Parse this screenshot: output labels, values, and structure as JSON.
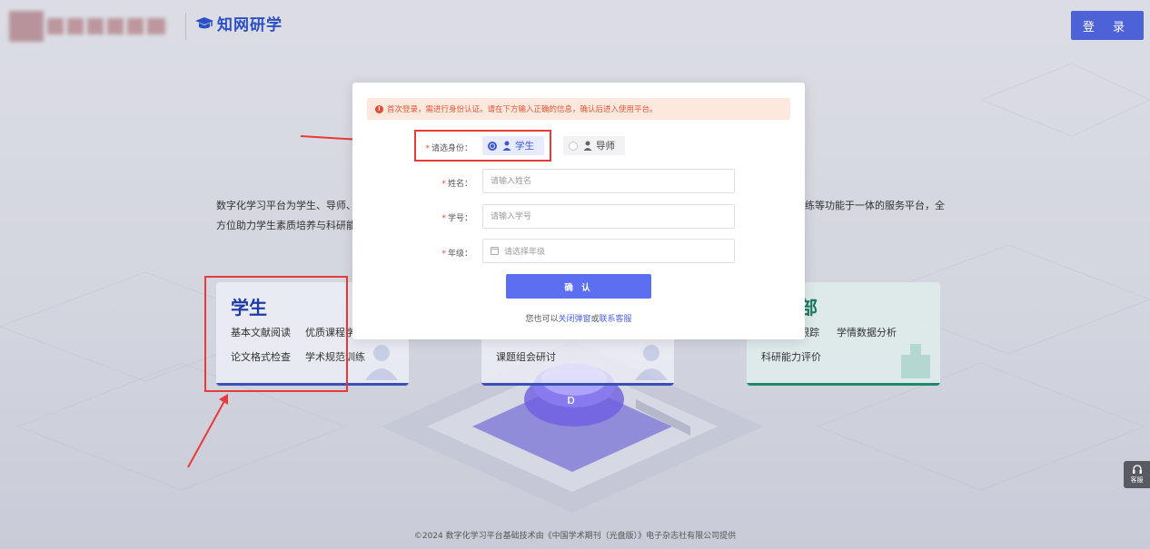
{
  "header": {
    "brand_logo_text": "知网研学",
    "login_label": "登 录"
  },
  "intro": {
    "left_text": "数字化学习平台为学生、导师、方位助力学生素质培养与科研能",
    "right_text": "练等功能于一体的服务平台，全"
  },
  "cards": {
    "student": {
      "title": "学生",
      "features": [
        "基本文献阅读",
        "优质课程学",
        "论文格式检查",
        "学术规范训练"
      ]
    },
    "mentor": {
      "features": [
        "课题组会研讨"
      ]
    },
    "dept": {
      "title": "部",
      "features": [
        "跟踪",
        "学情数据分析",
        "科研能力评价"
      ]
    }
  },
  "modal": {
    "notice": "首次登录，需进行身份认证。请在下方输入正确的信息，确认后进入使用平台。",
    "role_label": "请选身份：",
    "role_options": [
      "学生",
      "导师"
    ],
    "role_selected": "学生",
    "name_label": "姓名：",
    "name_placeholder": "请输入姓名",
    "id_label": "学号：",
    "id_placeholder": "请输入学号",
    "grade_label": "年级：",
    "grade_placeholder": "请选择年级",
    "confirm_label": "确 认",
    "footer_prefix": "您也可以",
    "footer_close_link": "关闭弹窗",
    "footer_or": "或",
    "footer_contact_link": "联系客服"
  },
  "copyright": "©2024 数字化学习平台基础技术由《中国学术期刊（光盘版）》电子杂志社有限公司提供",
  "service": {
    "label": "客服"
  },
  "colors": {
    "primary": "#4e62d8",
    "annotation": "#e83a3a",
    "notice_bg": "#fde8de",
    "notice_text": "#e2553a"
  }
}
